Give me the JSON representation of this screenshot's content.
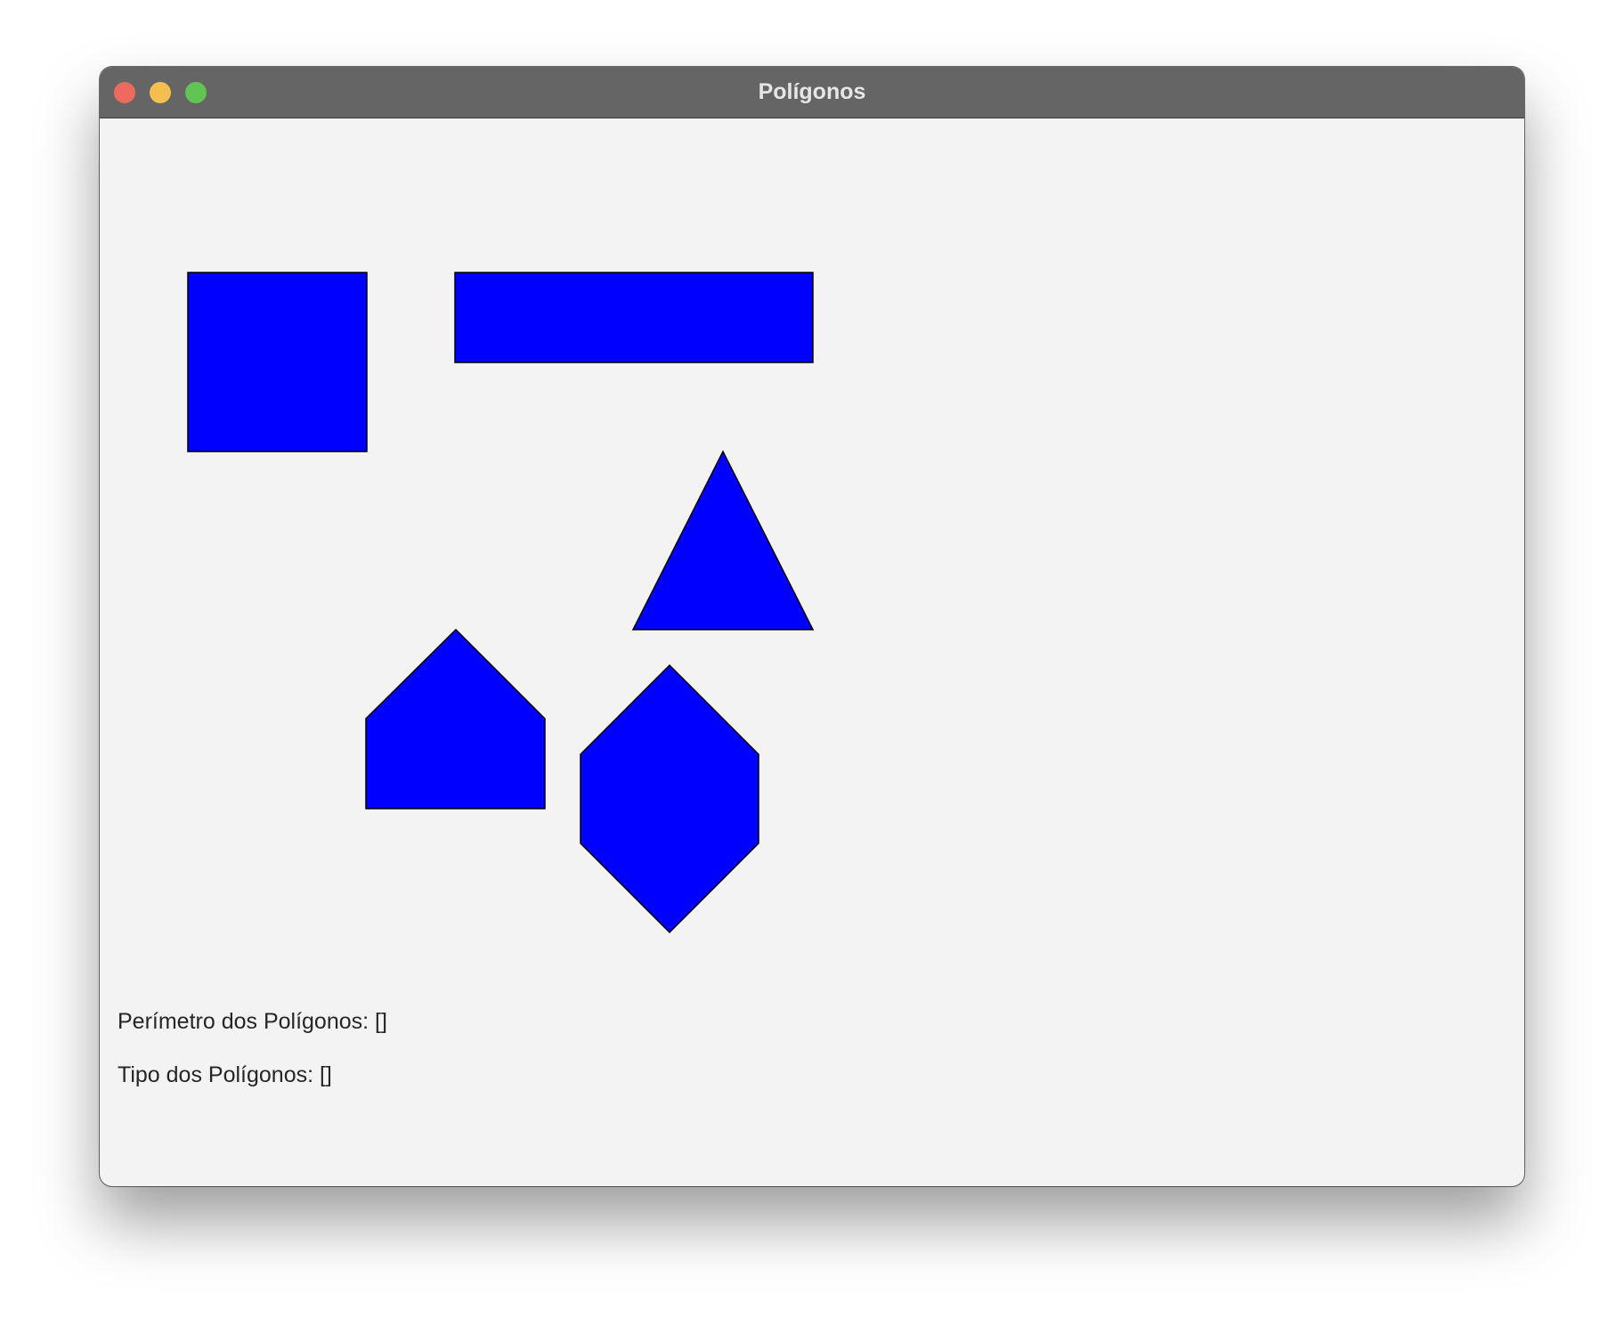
{
  "window": {
    "title": "Polígonos"
  },
  "colors": {
    "shape_fill": "#0000ff",
    "shape_stroke": "#000000",
    "canvas_background": "#f3f3f3",
    "titlebar": "#656565"
  },
  "shapes": [
    {
      "name": "square"
    },
    {
      "name": "rectangle"
    },
    {
      "name": "triangle"
    },
    {
      "name": "pentagon"
    },
    {
      "name": "hexagon"
    }
  ],
  "info": {
    "perimeter_text": "Perímetro dos Polígonos: []",
    "type_text": "Tipo dos Polígonos: []"
  }
}
